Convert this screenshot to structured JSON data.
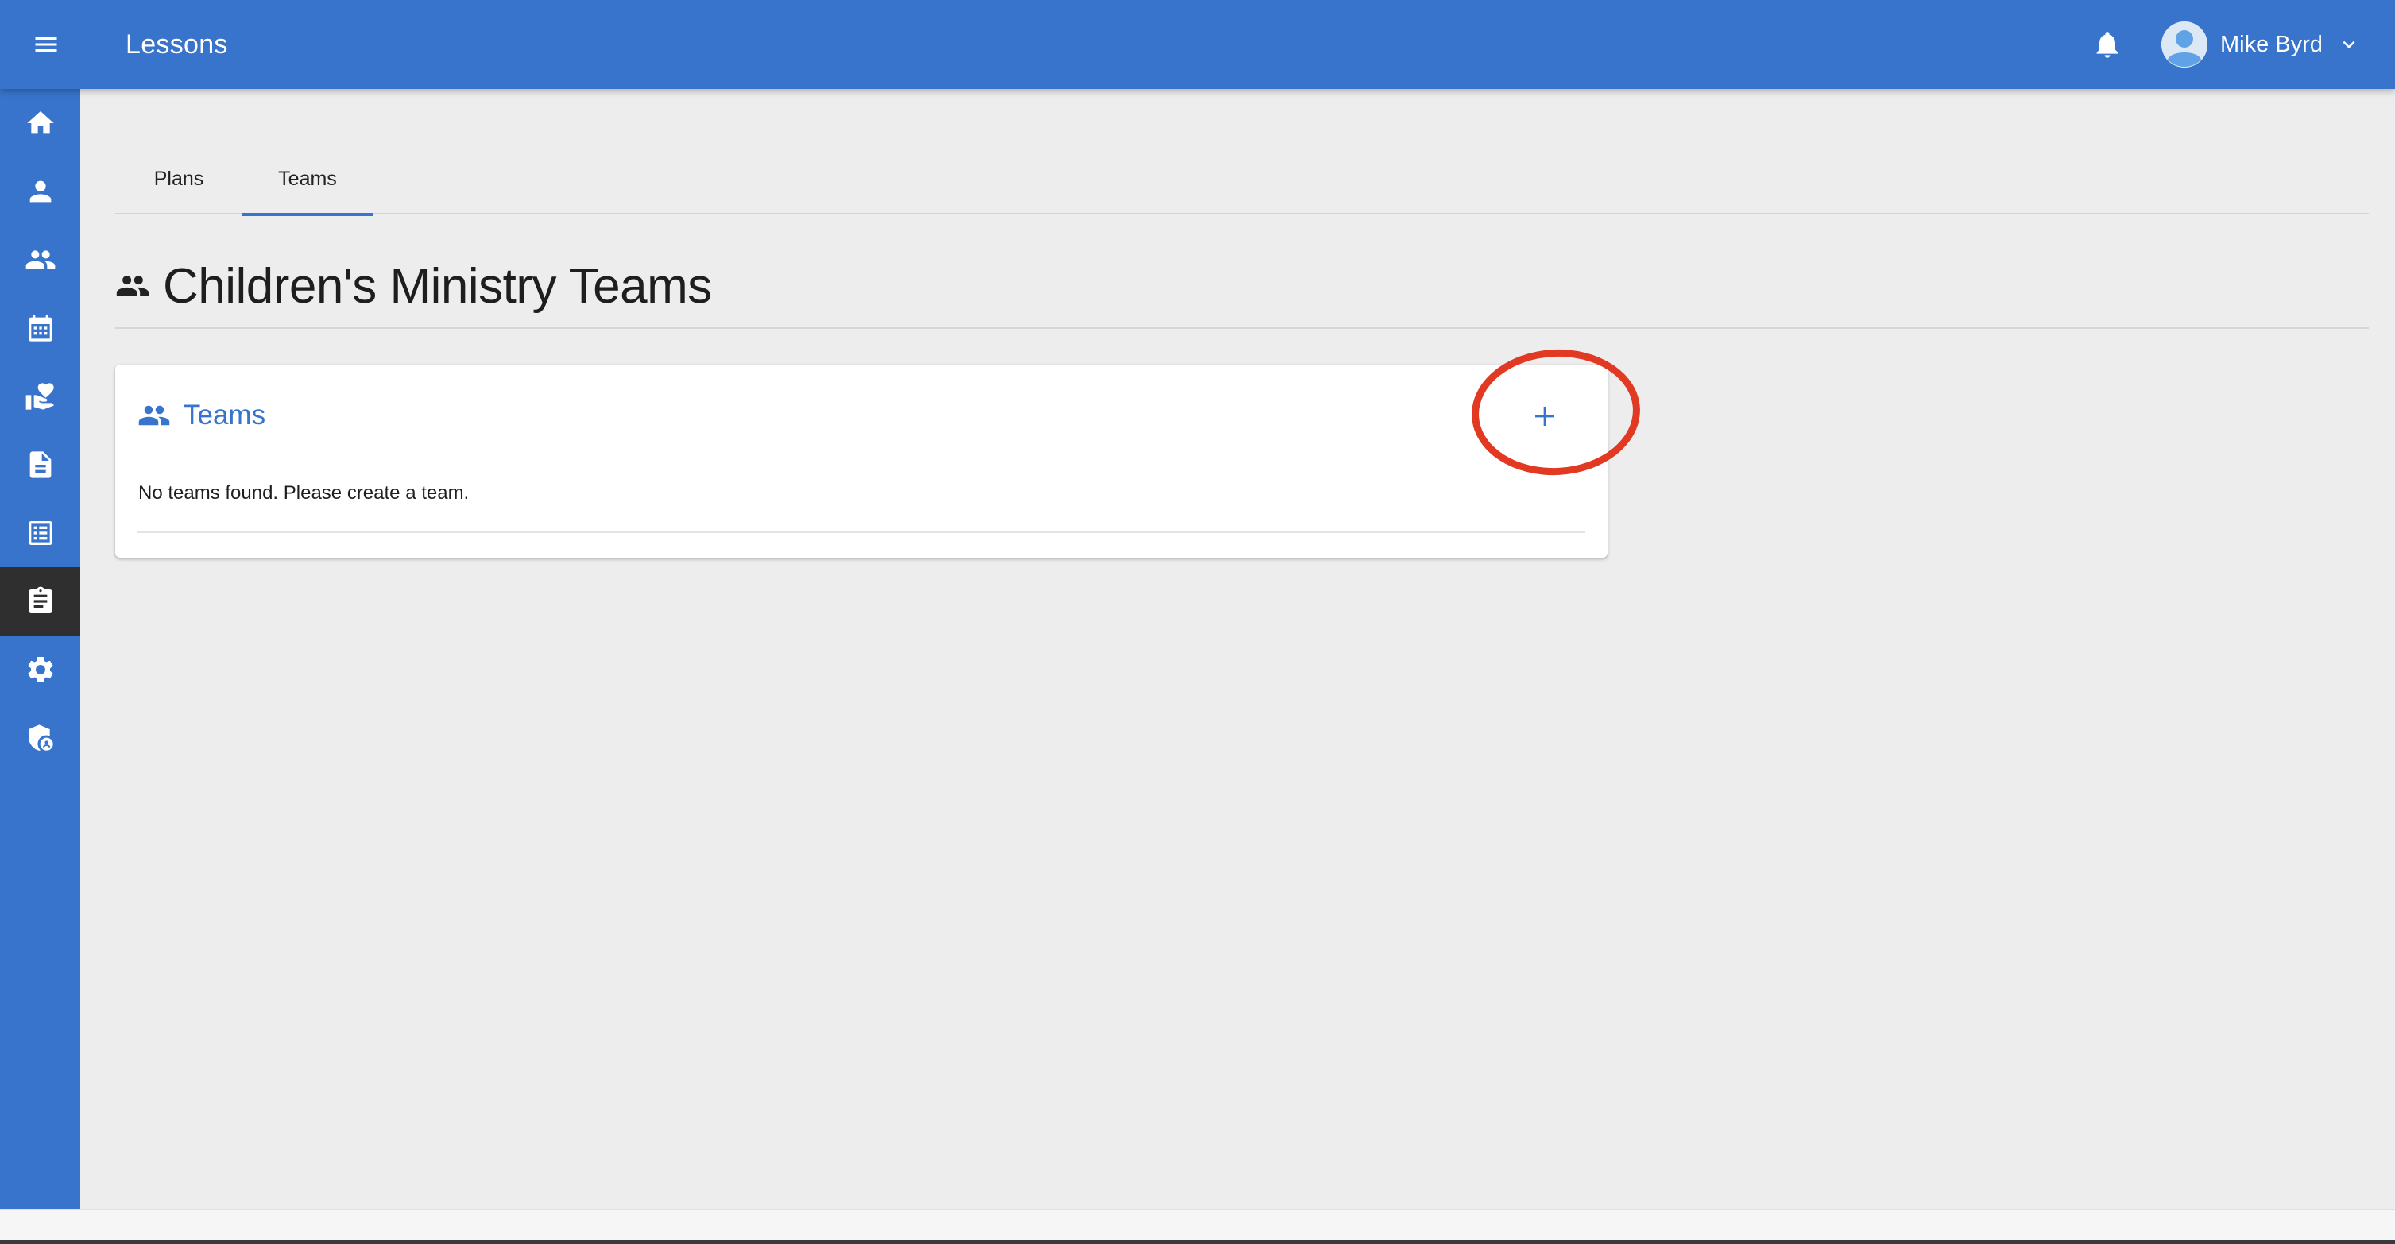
{
  "appbar": {
    "title": "Lessons",
    "user_name": "Mike Byrd",
    "icons": {
      "menu": "menu-icon",
      "notifications": "bell-icon",
      "avatar": "account-circle-icon",
      "dropdown": "chevron-down-icon"
    }
  },
  "sidebar": {
    "items": [
      {
        "icon": "home-icon",
        "active": false
      },
      {
        "icon": "person-icon",
        "active": false
      },
      {
        "icon": "people-icon",
        "active": false
      },
      {
        "icon": "calendar-icon",
        "active": false
      },
      {
        "icon": "volunteer-icon",
        "active": false
      },
      {
        "icon": "document-icon",
        "active": false
      },
      {
        "icon": "list-icon",
        "active": false
      },
      {
        "icon": "assignment-icon",
        "active": true
      },
      {
        "icon": "gear-icon",
        "active": false
      },
      {
        "icon": "admin-shield-icon",
        "active": false
      }
    ]
  },
  "tabs": [
    {
      "label": "Plans",
      "active": false
    },
    {
      "label": "Teams",
      "active": true
    }
  ],
  "page": {
    "title": "Children's Ministry Teams"
  },
  "card": {
    "title": "Teams",
    "empty_message": "No teams found. Please create a team.",
    "add_icon": "plus-icon"
  },
  "colors": {
    "primary": "#3874cc",
    "active_nav": "#2f2f2f",
    "background": "#ededed",
    "annotation": "#e23a22"
  }
}
